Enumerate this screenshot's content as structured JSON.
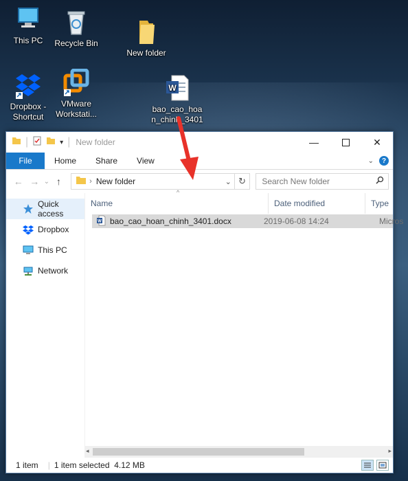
{
  "desktop": {
    "icons": [
      {
        "label": "This PC",
        "icon": "computer-icon"
      },
      {
        "label": "Recycle Bin",
        "icon": "recycle-bin-icon"
      },
      {
        "label": "New folder",
        "icon": "folder-icon"
      },
      {
        "label": "Dropbox - Shortcut",
        "icon": "dropbox-icon"
      },
      {
        "label": "VMware Workstati...",
        "icon": "vmware-icon"
      },
      {
        "label": "bao_cao_hoan_chinh_3401",
        "icon": "word-document-icon"
      }
    ]
  },
  "window": {
    "title": "New folder",
    "ribbon": {
      "file": "File",
      "tabs": [
        "Home",
        "Share",
        "View"
      ]
    },
    "address": "New folder",
    "search_placeholder": "Search New folder",
    "nav_items": [
      {
        "label": "Quick access",
        "icon": "star-icon",
        "selected": true
      },
      {
        "label": "Dropbox",
        "icon": "dropbox-icon",
        "selected": false
      },
      {
        "label": "This PC",
        "icon": "computer-icon",
        "selected": false
      },
      {
        "label": "Network",
        "icon": "network-icon",
        "selected": false
      }
    ],
    "columns": [
      "Name",
      "Date modified",
      "Type"
    ],
    "files": [
      {
        "name": "bao_cao_hoan_chinh_3401.docx",
        "date": "2019-06-08 14:24",
        "type": "Micros",
        "selected": true
      }
    ],
    "status": {
      "count": "1 item",
      "selection": "1 item selected  4.12 MB"
    }
  },
  "colors": {
    "accent": "#1979ca",
    "selection": "#d9d9d9",
    "arrow": "#e8322a"
  }
}
